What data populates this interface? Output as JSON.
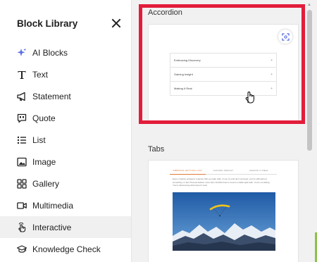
{
  "sidebar": {
    "title": "Block Library",
    "items": [
      {
        "label": "AI Blocks",
        "icon": "sparkle-icon"
      },
      {
        "label": "Text",
        "icon": "text-icon"
      },
      {
        "label": "Statement",
        "icon": "megaphone-icon"
      },
      {
        "label": "Quote",
        "icon": "quote-icon"
      },
      {
        "label": "List",
        "icon": "list-icon"
      },
      {
        "label": "Image",
        "icon": "image-icon"
      },
      {
        "label": "Gallery",
        "icon": "gallery-icon"
      },
      {
        "label": "Multimedia",
        "icon": "video-icon"
      },
      {
        "label": "Interactive",
        "icon": "pointer-icon"
      },
      {
        "label": "Knowledge Check",
        "icon": "graduation-cap-icon"
      }
    ],
    "active_item": "Interactive"
  },
  "preview": {
    "accordion": {
      "label": "Accordion",
      "rows": [
        "Embracing Discovery",
        "Gaining Insight",
        "Making It Real"
      ]
    },
    "tabs": {
      "label": "Tabs",
      "tabs": [
        "Embrace getting lost",
        "Gaining insight",
        "Making it real"
      ],
      "body_text": "Every creative endeavor requires that you take risks. If you try and don't succeed, you've still learned something. In fact Thomas Edison more than 10,000 times to invent a viable light bulb. You're not failing. You're discovering what doesn't work."
    }
  },
  "colors": {
    "highlight": "#e21d3b",
    "ai_accent": "#5b6ee1",
    "tab_accent": "#e07b39",
    "active_bg": "#f0f0f0"
  }
}
